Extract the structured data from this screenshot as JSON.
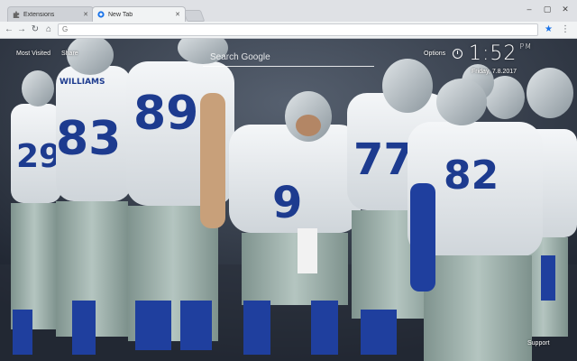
{
  "tabs": [
    {
      "title": "Extensions"
    },
    {
      "title": "New Tab"
    }
  ],
  "window": {
    "minimize": "–",
    "maximize": "▢",
    "close": "✕"
  },
  "toolbar": {
    "back": "←",
    "forward": "→",
    "reload": "↻",
    "home": "⌂",
    "star": "★",
    "menu": "⋮"
  },
  "omnibox": {
    "value": ""
  },
  "overlay": {
    "most_visited": "Most Visited",
    "share": "Share",
    "search_placeholder": "Search Google",
    "options": "Options",
    "time": "1:52",
    "ampm": "PM",
    "date": "Friday, 7.8.2017",
    "support": "Support"
  },
  "jerseys": [
    {
      "number": "29"
    },
    {
      "number": "83"
    },
    {
      "number": "89"
    },
    {
      "number": "9"
    },
    {
      "number": "77"
    },
    {
      "number": "82"
    }
  ],
  "nameplate": "WILLIAMS",
  "colors": {
    "jersey": "#e9ecef",
    "number": "#1d3b8f",
    "pants": "#9fb3ae",
    "sock": "#1f3f9e"
  }
}
